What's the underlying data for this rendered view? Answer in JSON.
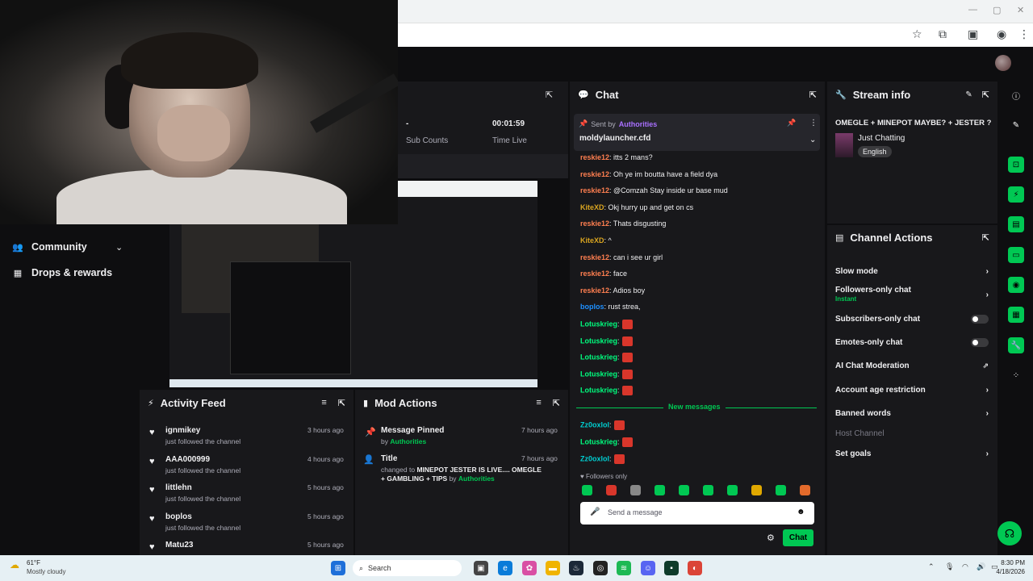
{
  "left_nav": {
    "items": [
      {
        "label": "Community"
      },
      {
        "label": "Drops & rewards"
      }
    ]
  },
  "stats": {
    "sub_counts": {
      "value": "-",
      "label": "Sub Counts"
    },
    "time_live": {
      "value": "00:01:59",
      "label": "Time Live"
    }
  },
  "chat": {
    "title": "Chat",
    "pinned": {
      "sent_by_label": "Sent by",
      "sender": "Authorities",
      "message": "moldylauncher.cfd"
    },
    "messages": [
      {
        "user": "reskie12",
        "text": ": itts 2 mans?",
        "color": "#ff7f50"
      },
      {
        "user": "reskie12",
        "text": ": Oh ye im boutta have a field dya",
        "color": "#ff7f50"
      },
      {
        "user": "reskie12",
        "text": ": @Comzah Stay inside ur base mud",
        "color": "#ff7f50"
      },
      {
        "user": "KiteXD",
        "text": ": Okj hurry up and get on cs",
        "color": "#daa520"
      },
      {
        "user": "reskie12",
        "text": ": Thats disgusting",
        "color": "#ff7f50"
      },
      {
        "user": "KiteXD",
        "text": ": ^",
        "color": "#daa520"
      },
      {
        "user": "reskie12",
        "text": ": can i see ur girl",
        "color": "#ff7f50"
      },
      {
        "user": "reskie12",
        "text": ": face",
        "color": "#ff7f50"
      },
      {
        "user": "reskie12",
        "text": ": Adios boy",
        "color": "#ff7f50"
      },
      {
        "user": "boplos",
        "text": ": rust strea,",
        "color": "#1e90ff"
      },
      {
        "user": "Lotuskrieg",
        "text": ":",
        "color": "#00ff7f"
      },
      {
        "user": "Lotuskrieg",
        "text": ":",
        "color": "#00ff7f"
      },
      {
        "user": "Lotuskrieg",
        "text": ":",
        "color": "#00ff7f"
      },
      {
        "user": "Lotuskrieg",
        "text": ":",
        "color": "#00ff7f"
      },
      {
        "user": "Lotuskrieg",
        "text": ":",
        "color": "#00ff7f"
      }
    ],
    "new_messages_label": "New messages",
    "new_messages": [
      {
        "user": "Zz0oxlol",
        "text": ":",
        "color": "#00ced1"
      },
      {
        "user": "Lotuskrieg",
        "text": ":",
        "color": "#00ff7f"
      },
      {
        "user": "Zz0oxlol",
        "text": ":",
        "color": "#00ced1"
      }
    ],
    "followers_only": "Followers only",
    "input_placeholder": "Send a message",
    "send_label": "Chat"
  },
  "stream_info": {
    "title_label": "Stream info",
    "stream_title": "OMEGLE + MINEPOT MAYBE? + JESTER ?",
    "category": "Just Chatting",
    "language": "English"
  },
  "channel_actions": {
    "title": "Channel Actions",
    "items": [
      {
        "label": "Slow mode"
      },
      {
        "label": "Followers-only chat",
        "sub": "Instant"
      },
      {
        "label": "Subscribers-only chat"
      },
      {
        "label": "Emotes-only chat"
      },
      {
        "label": "AI Chat Moderation"
      },
      {
        "label": "Account age restriction"
      },
      {
        "label": "Banned words"
      },
      {
        "label": "Host Channel"
      },
      {
        "label": "Set goals"
      }
    ]
  },
  "activity_feed": {
    "title": "Activity Feed",
    "items": [
      {
        "user": "ignmikey",
        "action": "just followed the channel",
        "time": "3 hours ago"
      },
      {
        "user": "AAA000999",
        "action": "just followed the channel",
        "time": "4 hours ago"
      },
      {
        "user": "littlehn",
        "action": "just followed the channel",
        "time": "5 hours ago"
      },
      {
        "user": "boplos",
        "action": "just followed the channel",
        "time": "5 hours ago"
      },
      {
        "user": "Matu23",
        "action": "",
        "time": "5 hours ago"
      }
    ]
  },
  "mod_actions": {
    "title": "Mod Actions",
    "items": [
      {
        "title": "Message Pinned",
        "by_label": "by",
        "by": "Authorities",
        "time": "7 hours ago"
      },
      {
        "title": "Title",
        "changed_label": "changed to",
        "value": "MINEPOT JESTER IS LIVE.... OMEGLE + GAMBLING + TIPS",
        "by_label": "by",
        "by": "Authorities",
        "time": "7 hours ago"
      }
    ]
  },
  "taskbar": {
    "weather_temp": "61°F",
    "weather_desc": "Mostly cloudy",
    "search_placeholder": "Search",
    "time": "8:30 PM",
    "date": "4/18/2026"
  }
}
